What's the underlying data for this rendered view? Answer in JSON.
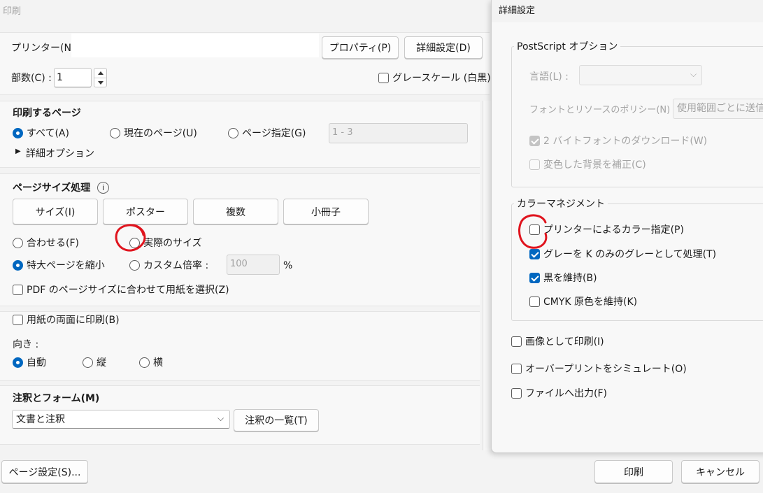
{
  "window": {
    "title": "印刷"
  },
  "printer": {
    "label": "プリンター(N) :",
    "value": "",
    "properties_button": "プロパティ(P)",
    "advanced_button": "詳細設定(D)"
  },
  "copies": {
    "label": "部数(C) :",
    "value": "1"
  },
  "grayscale": {
    "label": "グレースケール (白黒) で",
    "checked": false
  },
  "pages": {
    "heading": "印刷するページ",
    "all": "すべて(A)",
    "current": "現在のページ(U)",
    "range": "ページ指定(G)",
    "range_value": "1 - 3",
    "more_options": "詳細オプション"
  },
  "sizing": {
    "heading": "ページサイズ処理",
    "tabs": [
      "サイズ(I)",
      "ポスター",
      "複数",
      "小冊子"
    ],
    "fit": "合わせる(F)",
    "actual": "実際のサイズ",
    "shrink": "特大ページを縮小",
    "custom": "カスタム倍率 :",
    "custom_value": "100",
    "percent": "%",
    "choose_paper": "PDF のページサイズに合わせて用紙を選択(Z)"
  },
  "duplex": {
    "label": "用紙の両面に印刷(B)"
  },
  "orientation": {
    "label": "向き :",
    "auto": "自動",
    "portrait": "縦",
    "landscape": "横"
  },
  "annotations": {
    "heading": "注釈とフォーム(M)",
    "selected": "文書と注釈",
    "summary_button": "注釈の一覧(T)"
  },
  "bottom": {
    "page_setup": "ページ設定(S)...",
    "print": "印刷",
    "cancel": "キャンセル"
  },
  "advanced": {
    "title": "詳細設定",
    "postscript": {
      "legend": "PostScript オプション",
      "language_label": "言語(L) :",
      "font_policy_label": "フォントとリソースのポリシー(N) :",
      "font_policy_value": "使用範囲ごとに送信",
      "download_2byte": "2 バイトフォントのダウンロード(W)",
      "correct_background": "変色した背景を補正(C)"
    },
    "color": {
      "legend": "カラーマネジメント",
      "printer_color": "プリンターによるカラー指定(P)",
      "gray_k": "グレーを K のみのグレーとして処理(T)",
      "keep_black": "黒を維持(B)",
      "keep_cmyk": "CMYK 原色を維持(K)"
    },
    "print_as_image": "画像として印刷(I)",
    "simulate_overprint": "オーバープリントをシミュレート(O)",
    "print_to_file": "ファイルへ出力(F)"
  },
  "annotation_color": "#e0141e"
}
